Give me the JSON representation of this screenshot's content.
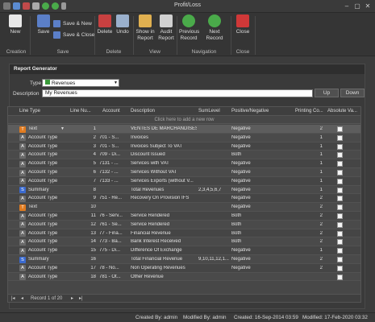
{
  "window": {
    "title": "Profit/Loss"
  },
  "ribbon": {
    "new": "New",
    "save": "Save",
    "save_new": "Save & New",
    "save_close": "Save & Close",
    "delete": "Delete",
    "undo": "Undo",
    "show_in_report": "Show in Report",
    "audit_report": "Audit Report",
    "previous_record": "Previous Record",
    "next_record": "Next Record",
    "close": "Close",
    "groups": {
      "creation": "Creation",
      "save": "Save",
      "delete": "Delete",
      "view": "View",
      "navigation": "Navigation",
      "close": "Close"
    }
  },
  "panel": {
    "title": "Report Generator",
    "type_label": "Type",
    "type_value": "Revenues",
    "description_label": "Description",
    "description_value": "My Revenues",
    "up": "Up",
    "down": "Down"
  },
  "grid": {
    "columns": [
      "Line Type",
      "Line Nu...",
      "Account",
      "Description",
      "SumLevel",
      "Positive/Negative",
      "Printing Co...",
      "Absolute Va..."
    ],
    "new_row": "Click here to add a new row",
    "rows": [
      {
        "type": "Text",
        "icon": "T",
        "line": "1",
        "account": "",
        "description": "VENTES DE MARCHANDISES",
        "sum": "",
        "pn": "Negative",
        "print": "2",
        "selected": true
      },
      {
        "type": "Account Type",
        "icon": "A",
        "line": "2",
        "account": "701  -  S...",
        "description": "Invoices",
        "sum": "",
        "pn": "Negative",
        "print": "1"
      },
      {
        "type": "Account Type",
        "icon": "A",
        "line": "3",
        "account": "701  -  S...",
        "description": "Invoices Subject To VAT",
        "sum": "",
        "pn": "Negative",
        "print": "1"
      },
      {
        "type": "Account Type",
        "icon": "A",
        "line": "4",
        "account": "709  -  Di...",
        "description": "Discount Issued",
        "sum": "",
        "pn": "Both",
        "print": "1"
      },
      {
        "type": "Account Type",
        "icon": "A",
        "line": "5",
        "account": "7131  -  ...",
        "description": "Services with VAT",
        "sum": "",
        "pn": "Negative",
        "print": "1"
      },
      {
        "type": "Account Type",
        "icon": "A",
        "line": "6",
        "account": "7132  -  ...",
        "description": "Services Without VAT",
        "sum": "",
        "pn": "Negative",
        "print": "1"
      },
      {
        "type": "Account Type",
        "icon": "A",
        "line": "7",
        "account": "7133  -  ...",
        "description": "Services Exports (without V...",
        "sum": "",
        "pn": "Negative",
        "print": "1"
      },
      {
        "type": "Summary",
        "icon": "S",
        "line": "8",
        "account": "",
        "description": "Total Revenues",
        "sum": "2,3,4,5,6,7",
        "pn": "Negative",
        "print": "1"
      },
      {
        "type": "Account Type",
        "icon": "A",
        "line": "9",
        "account": "751  -  Re...",
        "description": "Recovery On Provision IFS",
        "sum": "",
        "pn": "Negative",
        "print": "2"
      },
      {
        "type": "Text",
        "icon": "T",
        "line": "10",
        "account": "",
        "description": "",
        "sum": "",
        "pn": "Negative",
        "print": "2"
      },
      {
        "type": "Account Type",
        "icon": "A",
        "line": "11",
        "account": "76  -  Serv...",
        "description": "Service Rendered",
        "sum": "",
        "pn": "Both",
        "print": "2"
      },
      {
        "type": "Account Type",
        "icon": "A",
        "line": "12",
        "account": "761  -  Se...",
        "description": "Service Rendered",
        "sum": "",
        "pn": "Both",
        "print": "2"
      },
      {
        "type": "Account Type",
        "icon": "A",
        "line": "13",
        "account": "77  -  Fina...",
        "description": "Financial Revenue",
        "sum": "",
        "pn": "Both",
        "print": "2"
      },
      {
        "type": "Account Type",
        "icon": "A",
        "line": "14",
        "account": "773  -  Ba...",
        "description": "Bank Interest Received",
        "sum": "",
        "pn": "Both",
        "print": "2"
      },
      {
        "type": "Account Type",
        "icon": "A",
        "line": "15",
        "account": "775  -  Di...",
        "description": "Difference Of Exchange",
        "sum": "",
        "pn": "Negative",
        "print": "1"
      },
      {
        "type": "Summary",
        "icon": "S",
        "line": "16",
        "account": "",
        "description": "Total Financial Revenue",
        "sum": "9,10,11,12,1...",
        "pn": "Negative",
        "print": "2"
      },
      {
        "type": "Account Type",
        "icon": "A",
        "line": "17",
        "account": "78  -  No...",
        "description": "Non Operating Revenues",
        "sum": "",
        "pn": "Negative",
        "print": "2"
      },
      {
        "type": "Account Type",
        "icon": "A",
        "line": "18",
        "account": "781  -  Ot...",
        "description": "Other Revenue",
        "sum": "",
        "pn": "",
        "print": ""
      }
    ],
    "nav": "Record 1 of 20"
  },
  "status": {
    "created_by": "Created By: admin",
    "modified_by": "Modified By: admin",
    "created": "Created: 16-Sep-2014 03:59",
    "modified": "Modified: 17-Feb-2020 03:32"
  },
  "colors": {
    "text_icon": "#e07b20",
    "account_icon": "#6a6a6a",
    "summary_icon": "#3a6ad0",
    "selected_row": "#5d5d5d"
  }
}
